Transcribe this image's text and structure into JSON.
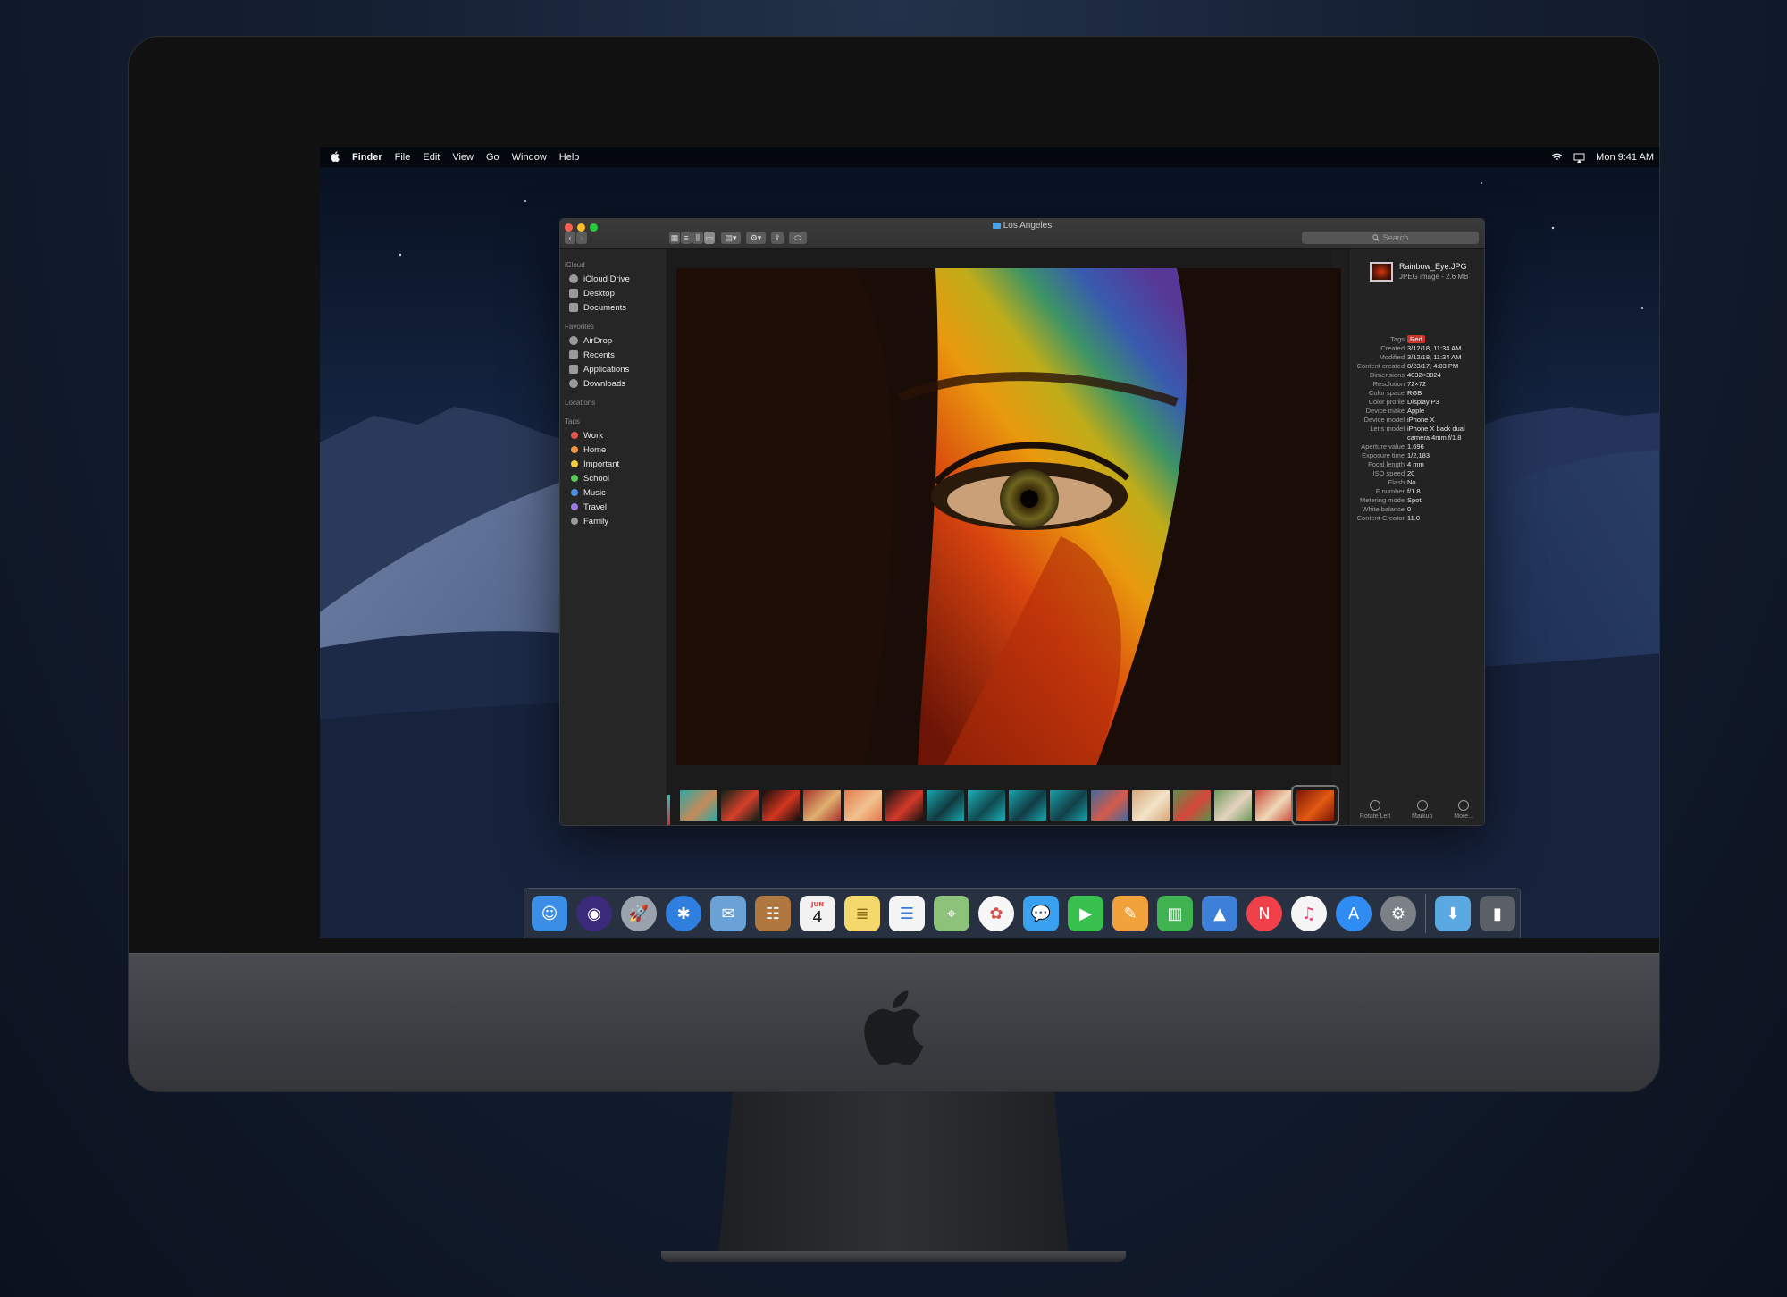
{
  "menubar": {
    "app": "Finder",
    "menus": [
      "File",
      "Edit",
      "View",
      "Go",
      "Window",
      "Help"
    ],
    "clock": "Mon 9:41 AM"
  },
  "finder": {
    "window_title": "Los Angeles",
    "search_placeholder": "Search",
    "sidebar": {
      "icloud_header": "iCloud",
      "icloud_items": [
        {
          "label": "iCloud Drive",
          "icon": "cloud-icon"
        },
        {
          "label": "Desktop",
          "icon": "desktop-icon"
        },
        {
          "label": "Documents",
          "icon": "documents-icon"
        }
      ],
      "favorites_header": "Favorites",
      "favorites_items": [
        {
          "label": "AirDrop",
          "icon": "airdrop-icon"
        },
        {
          "label": "Recents",
          "icon": "recents-icon"
        },
        {
          "label": "Applications",
          "icon": "applications-icon"
        },
        {
          "label": "Downloads",
          "icon": "downloads-icon"
        }
      ],
      "locations_header": "Locations",
      "tags_header": "Tags",
      "tags": [
        {
          "label": "Work",
          "color": "#e5534b"
        },
        {
          "label": "Home",
          "color": "#f0953a"
        },
        {
          "label": "Important",
          "color": "#f5cf3a"
        },
        {
          "label": "School",
          "color": "#5ec759"
        },
        {
          "label": "Music",
          "color": "#4a90e2"
        },
        {
          "label": "Travel",
          "color": "#9b7be0"
        },
        {
          "label": "Family",
          "color": "#9a9a9a"
        }
      ]
    },
    "inspector": {
      "file_name": "Rainbow_Eye.JPG",
      "file_kind": "JPEG image - 2.6 MB",
      "tag_label": "Tags",
      "tag_value": "Red",
      "metadata": [
        {
          "k": "Created",
          "v": "3/12/18, 11:34 AM"
        },
        {
          "k": "Modified",
          "v": "3/12/18, 11:34 AM"
        },
        {
          "k": "Content created",
          "v": "8/23/17, 4:03 PM"
        },
        {
          "k": "Dimensions",
          "v": "4032×3024"
        },
        {
          "k": "Resolution",
          "v": "72×72"
        },
        {
          "k": "Color space",
          "v": "RGB"
        },
        {
          "k": "Color profile",
          "v": "Display P3"
        },
        {
          "k": "Device make",
          "v": "Apple"
        },
        {
          "k": "Device model",
          "v": "iPhone X"
        },
        {
          "k": "Lens model",
          "v": "iPhone X back dual"
        },
        {
          "k": "",
          "v": "camera 4mm f/1.8"
        },
        {
          "k": "Aperture value",
          "v": "1.696"
        },
        {
          "k": "Exposure time",
          "v": "1/2,183"
        },
        {
          "k": "Focal length",
          "v": "4 mm"
        },
        {
          "k": "ISO speed",
          "v": "20"
        },
        {
          "k": "Flash",
          "v": "No"
        },
        {
          "k": "F number",
          "v": "f/1.8"
        },
        {
          "k": "Metering mode",
          "v": "Spot"
        },
        {
          "k": "White balance",
          "v": "0"
        },
        {
          "k": "Content Creator",
          "v": "11.0"
        }
      ],
      "actions": [
        "Rotate Left",
        "Markup",
        "More..."
      ]
    },
    "thumbnails": [
      {
        "colors": [
          "#2aa9a4",
          "#c48a5a"
        ]
      },
      {
        "colors": [
          "#0c2016",
          "#d6402a"
        ]
      },
      {
        "colors": [
          "#140d0d",
          "#d2351f"
        ]
      },
      {
        "colors": [
          "#a6322a",
          "#e0b070"
        ]
      },
      {
        "colors": [
          "#e27a4c",
          "#f2c291"
        ]
      },
      {
        "colors": [
          "#161010",
          "#d33a2a"
        ]
      },
      {
        "colors": [
          "#1aa7b0",
          "#103a40"
        ]
      },
      {
        "colors": [
          "#1fb0b8",
          "#0f4a50"
        ]
      },
      {
        "colors": [
          "#19a6ae",
          "#113b44"
        ]
      },
      {
        "colors": [
          "#18a1aa",
          "#123f46"
        ]
      },
      {
        "colors": [
          "#3f6a9e",
          "#d65a4a"
        ]
      },
      {
        "colors": [
          "#d7a87a",
          "#f3e3c9"
        ]
      },
      {
        "colors": [
          "#5d8f4a",
          "#d6463a"
        ]
      },
      {
        "colors": [
          "#6f9a5a",
          "#e5d3c0"
        ]
      },
      {
        "colors": [
          "#c74a3a",
          "#f0d9b8"
        ]
      },
      {
        "colors": [
          "#7a1606",
          "#e35a12"
        ]
      }
    ]
  },
  "dock": [
    {
      "icon": "finder-icon",
      "color": "#3a8ee6"
    },
    {
      "icon": "siri-icon",
      "color": "#3b2a7a"
    },
    {
      "icon": "launchpad-icon",
      "color": "#9aa3ad"
    },
    {
      "icon": "safari-icon",
      "color": "#2f7fe0"
    },
    {
      "icon": "mail-icon",
      "color": "#6aa2d8"
    },
    {
      "icon": "contacts-icon",
      "color": "#b0773e"
    },
    {
      "icon": "calendar-icon",
      "color": "#f2f2f2",
      "month": "JUN",
      "day": "4"
    },
    {
      "icon": "notes-icon",
      "color": "#f5d86b"
    },
    {
      "icon": "reminders-icon",
      "color": "#f4f4f4"
    },
    {
      "icon": "maps-icon",
      "color": "#8cc27a"
    },
    {
      "icon": "photos-icon",
      "color": "#f7f7f7"
    },
    {
      "icon": "messages-icon",
      "color": "#3aa0f0"
    },
    {
      "icon": "facetime-icon",
      "color": "#38c04e"
    },
    {
      "icon": "pages-icon",
      "color": "#f1a23a"
    },
    {
      "icon": "numbers-icon",
      "color": "#3eb34f"
    },
    {
      "icon": "keynote-icon",
      "color": "#3e7fd8"
    },
    {
      "icon": "news-icon",
      "color": "#f0404a"
    },
    {
      "icon": "music-icon",
      "color": "#f5f5f5"
    },
    {
      "icon": "app-store-icon",
      "color": "#2f8cf2"
    },
    {
      "icon": "system-preferences-icon",
      "color": "#7c8087"
    },
    {
      "icon": "downloads-folder-icon",
      "color": "#5aa9e3"
    },
    {
      "icon": "trash-icon",
      "color": "#5b5f66"
    }
  ]
}
